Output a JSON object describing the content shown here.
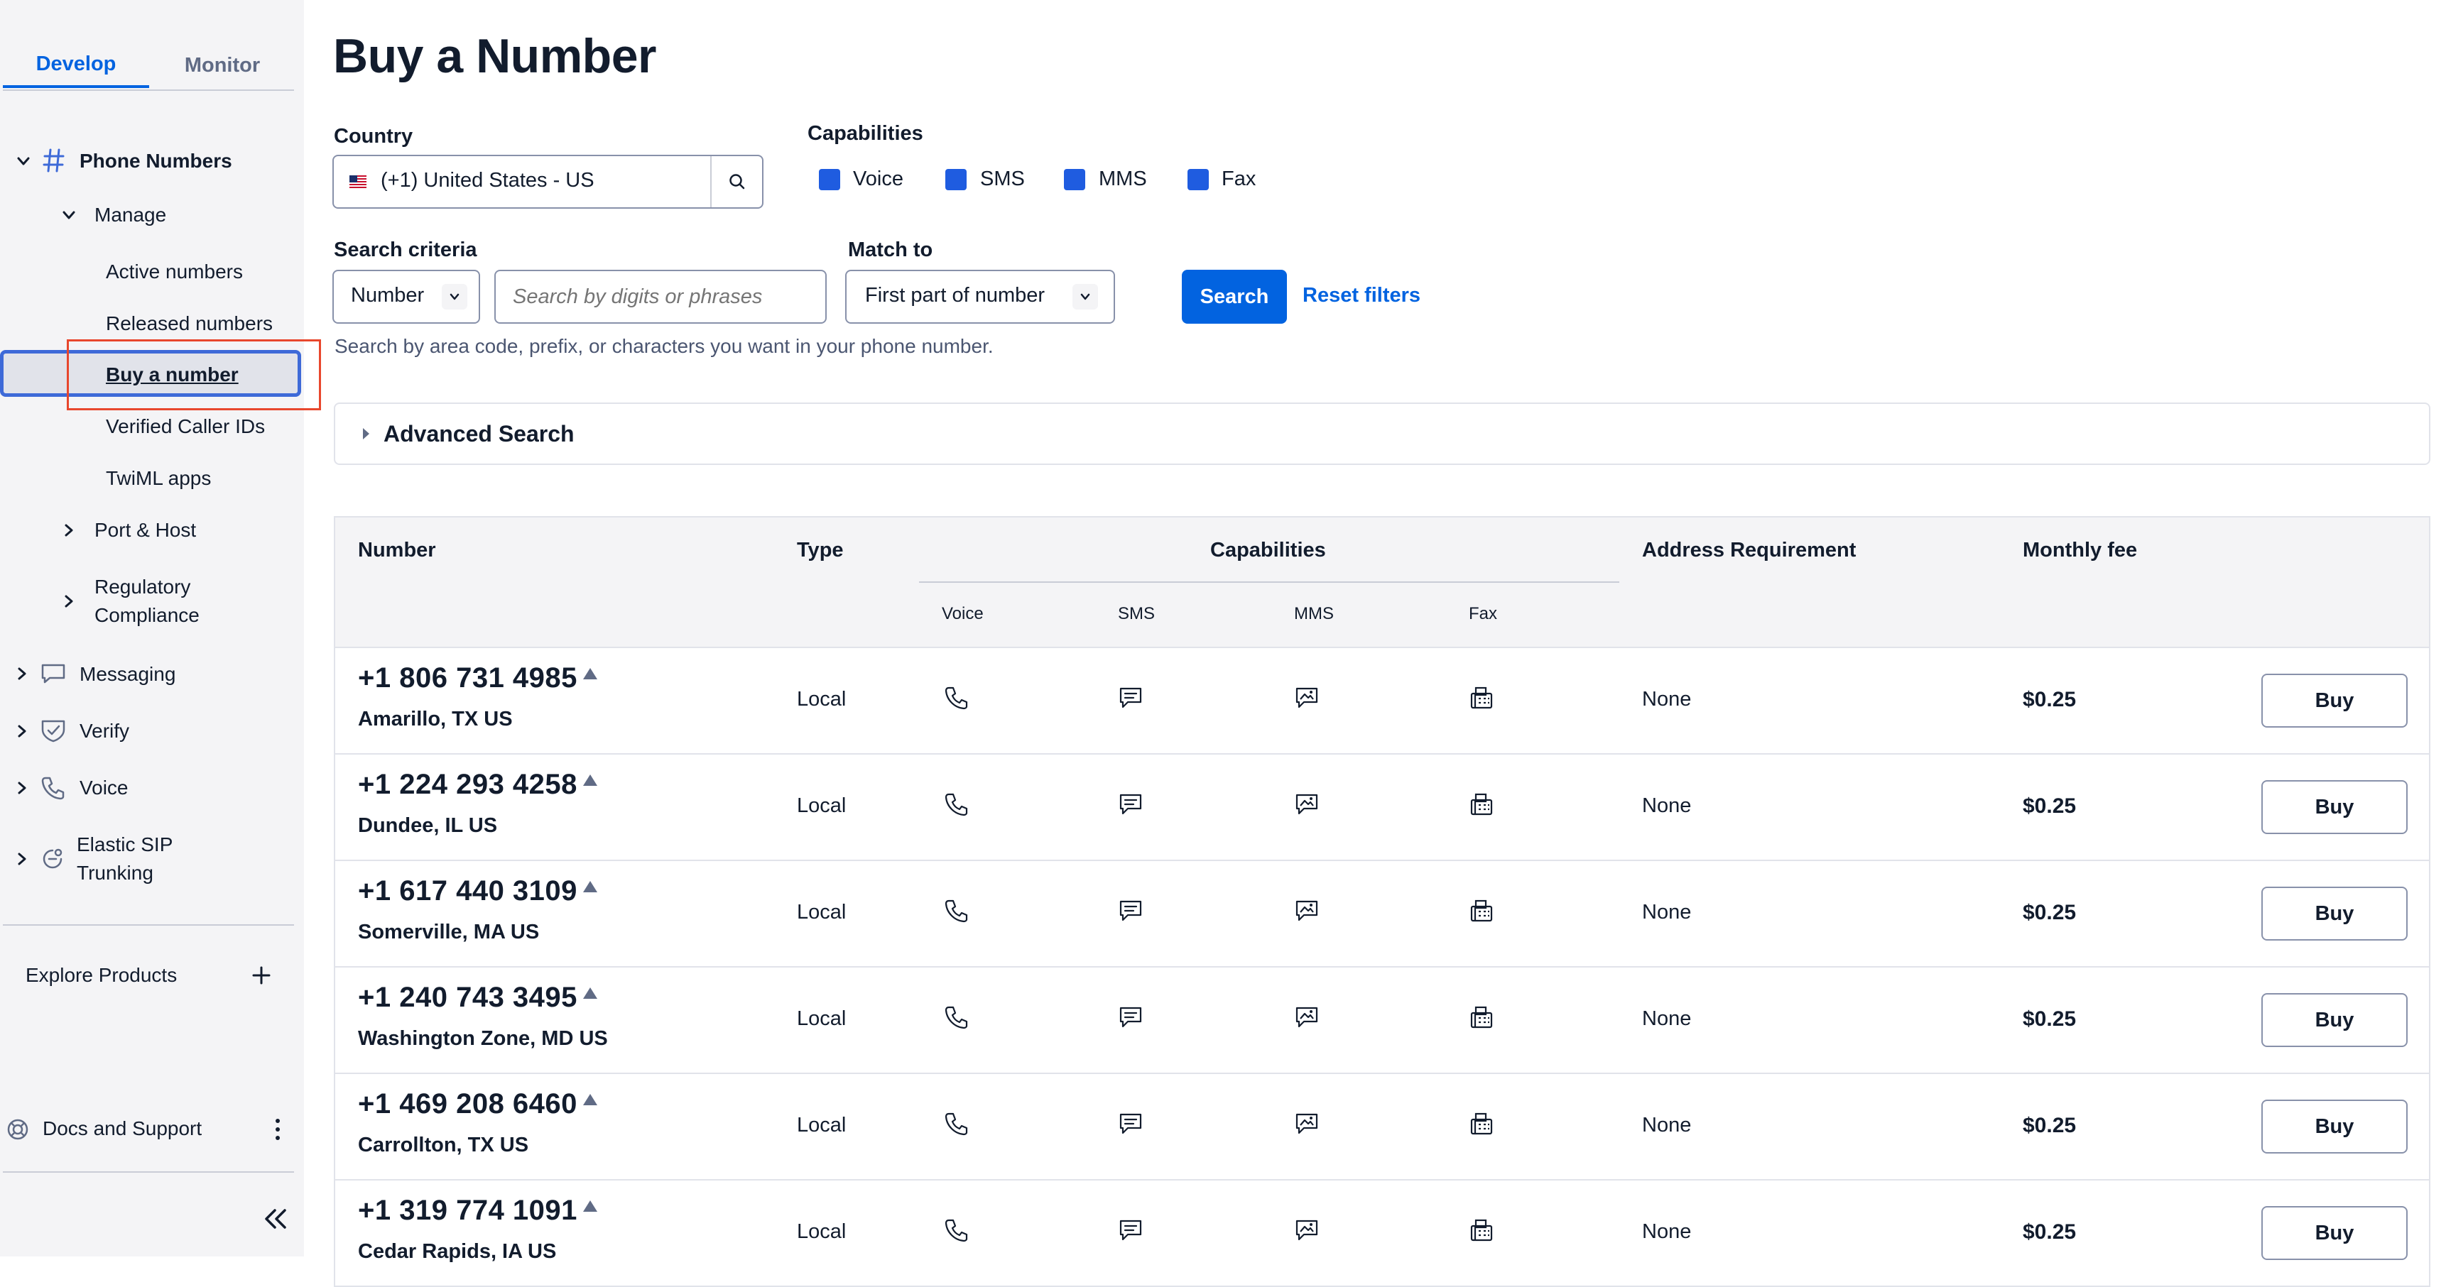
{
  "sidebar": {
    "tabs": [
      "Develop",
      "Monitor"
    ],
    "phone_numbers": "Phone Numbers",
    "manage": "Manage",
    "manage_items": [
      "Active numbers",
      "Released numbers",
      "Buy a number",
      "Verified Caller IDs",
      "TwiML apps"
    ],
    "port_host": "Port & Host",
    "regulatory": [
      "Regulatory",
      "Compliance"
    ],
    "messaging": "Messaging",
    "verify": "Verify",
    "voice": "Voice",
    "elastic_sip": [
      "Elastic SIP",
      "Trunking"
    ],
    "explore_products": "Explore Products",
    "docs_support": "Docs and Support"
  },
  "page": {
    "title": "Buy a Number",
    "country_label": "Country",
    "country_value": "(+1) United States - US",
    "capabilities_label": "Capabilities",
    "capabilities": [
      "Voice",
      "SMS",
      "MMS",
      "Fax"
    ],
    "search_criteria_label": "Search criteria",
    "search_criteria_value": "Number",
    "search_placeholder": "Search by digits or phrases",
    "match_to_label": "Match to",
    "match_to_value": "First part of number",
    "search_button": "Search",
    "reset_filters": "Reset filters",
    "help_text": "Search by area code, prefix, or characters you want in your phone number.",
    "advanced_search": "Advanced Search"
  },
  "table": {
    "headers": {
      "number": "Number",
      "type": "Type",
      "capabilities": "Capabilities",
      "address": "Address Requirement",
      "fee": "Monthly fee"
    },
    "cap_headers": [
      "Voice",
      "SMS",
      "MMS",
      "Fax"
    ],
    "rows": [
      {
        "number": "+1 806 731 4985",
        "location": "Amarillo, TX US",
        "type": "Local",
        "address": "None",
        "fee": "$0.25",
        "buy": "Buy"
      },
      {
        "number": "+1 224 293 4258",
        "location": "Dundee, IL US",
        "type": "Local",
        "address": "None",
        "fee": "$0.25",
        "buy": "Buy"
      },
      {
        "number": "+1 617 440 3109",
        "location": "Somerville, MA US",
        "type": "Local",
        "address": "None",
        "fee": "$0.25",
        "buy": "Buy"
      },
      {
        "number": "+1 240 743 3495",
        "location": "Washington Zone, MD US",
        "type": "Local",
        "address": "None",
        "fee": "$0.25",
        "buy": "Buy"
      },
      {
        "number": "+1 469 208 6460",
        "location": "Carrollton, TX US",
        "type": "Local",
        "address": "None",
        "fee": "$0.25",
        "buy": "Buy"
      },
      {
        "number": "+1 319 774 1091",
        "location": "Cedar Rapids, IA US",
        "type": "Local",
        "address": "None",
        "fee": "$0.25",
        "buy": "Buy"
      }
    ]
  },
  "colors": {
    "accent": "#0263e0",
    "checkbox": "#1f5ce0",
    "highlight_box": "#e8472d"
  }
}
